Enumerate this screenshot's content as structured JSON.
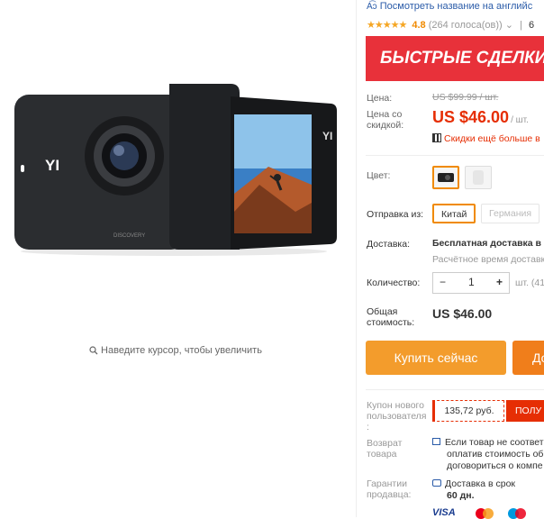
{
  "gallery": {
    "zoom_hint": "Наведите курсор, чтобы увеличить",
    "camera": {
      "brand_front": "YI",
      "brand_back": "YI",
      "model_text": "DISCOVERY"
    }
  },
  "header": {
    "translate_link": "Посмотреть название на английс",
    "rating": "4.8",
    "reviews": "(264 голоса(ов))",
    "extra": "6"
  },
  "deal_banner": {
    "text": "БЫСТРЫЕ СДЕЛКИ"
  },
  "pricing": {
    "price_label": "Цена:",
    "old_price": "US $99.99 / шт.",
    "discount_label_1": "Цена со",
    "discount_label_2": "скидкой:",
    "price": "US $46.00",
    "price_unit": "/ шт.",
    "app_discount": "Скидки ещё больше в"
  },
  "options": {
    "color_label": "Цвет:",
    "ship_from_label": "Отправка из:",
    "ship_from_options": [
      {
        "label": "Китай",
        "state": "selected"
      },
      {
        "label": "Германия",
        "state": "disabled"
      }
    ]
  },
  "delivery": {
    "label": "Доставка:",
    "value": "Бесплатная доставка в",
    "estimate": "Расчётное время доставк"
  },
  "quantity": {
    "label": "Количество:",
    "value": "1",
    "minus": "−",
    "plus": "+",
    "available": "шт. (41"
  },
  "total": {
    "label_1": "Общая",
    "label_2": "стоимость:",
    "value": "US $46.00"
  },
  "actions": {
    "buy_now": "Купить сейчас",
    "add_to_cart": "До"
  },
  "coupon": {
    "label_1": "Купон нового",
    "label_2": "пользователя",
    "label_3": ":",
    "value": "135,72 руб.",
    "get_button": "ПОЛУ"
  },
  "return": {
    "label_1": "Возврат",
    "label_2": "товара",
    "line_1": "Если товар не соответ",
    "line_2": "оплатив стоимость об",
    "line_3": "договориться о компе"
  },
  "guarantee": {
    "label_1": "Гарантии",
    "label_2": "продавца:",
    "line_1": "Доставка в срок",
    "line_2": "60 дн."
  },
  "payment": {
    "visa": "VISA"
  },
  "colors": {
    "accent": "#f08a00",
    "price": "#e62e04",
    "deal": "#e8313a",
    "button": "#f39c2c",
    "link": "#2a5ba8"
  }
}
